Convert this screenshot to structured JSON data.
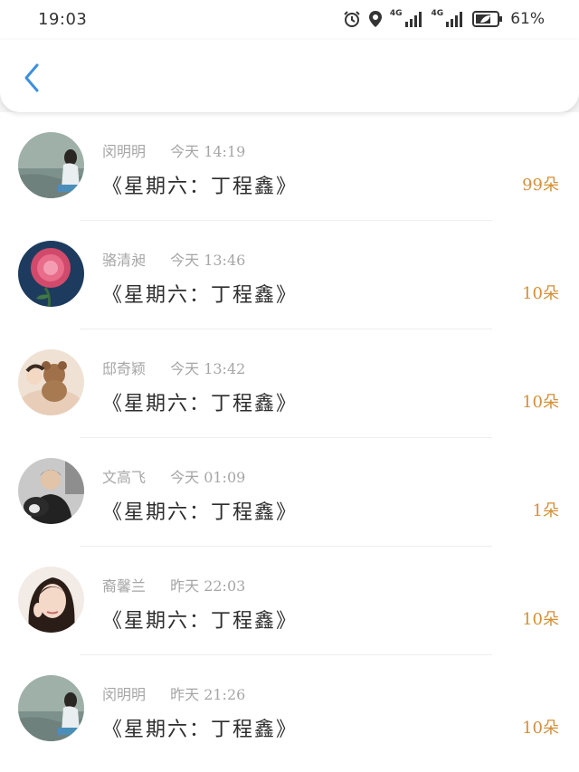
{
  "status_bar": {
    "time": "19:03",
    "network_1": "4G",
    "network_2": "4G",
    "battery": "61%"
  },
  "header": {
    "back_icon": "chevron-left-icon",
    "accent_color": "#3d8fe0"
  },
  "gifts": [
    {
      "user": "闵明明",
      "time": "今天 14:19",
      "message": "《星期六：丁程鑫》",
      "count": "99朵",
      "avatar": "sea-girl"
    },
    {
      "user": "骆清昶",
      "time": "今天 13:46",
      "message": "《星期六：丁程鑫》",
      "count": "10朵",
      "avatar": "rose"
    },
    {
      "user": "邸奇颖",
      "time": "今天 13:42",
      "message": "《星期六：丁程鑫》",
      "count": "10朵",
      "avatar": "teddy-bear"
    },
    {
      "user": "文高飞",
      "time": "今天 01:09",
      "message": "《星期六：丁程鑫》",
      "count": "1朵",
      "avatar": "dog-boy"
    },
    {
      "user": "裔馨兰",
      "time": "昨天 22:03",
      "message": "《星期六：丁程鑫》",
      "count": "10朵",
      "avatar": "girl-portrait"
    },
    {
      "user": "闵明明",
      "time": "昨天 21:26",
      "message": "《星期六：丁程鑫》",
      "count": "10朵",
      "avatar": "sea-girl"
    }
  ],
  "colors": {
    "count": "#d48f3a",
    "meta": "#a6a6a6",
    "message": "#2d2d2d"
  }
}
